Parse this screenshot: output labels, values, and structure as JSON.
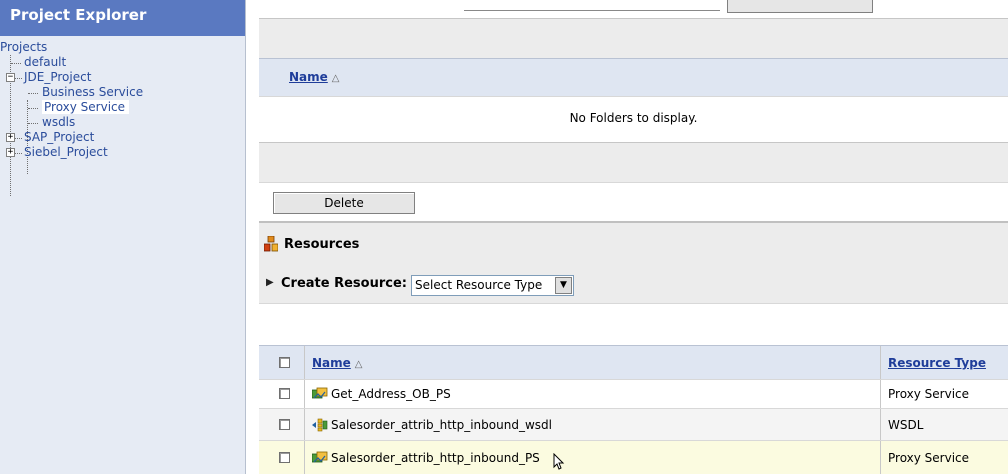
{
  "sidebar": {
    "title": "Project Explorer",
    "root_label": "Projects",
    "items": [
      {
        "label": "default"
      },
      {
        "label": "JDE_Project",
        "expander": "−"
      },
      {
        "label": "Business Service"
      },
      {
        "label": "Proxy Service"
      },
      {
        "label": "wsdls"
      },
      {
        "label": "SAP_Project",
        "expander": "+"
      },
      {
        "label": "Siebel_Project",
        "expander": "+"
      }
    ]
  },
  "folders": {
    "name_header": "Name",
    "sort_indicator": "△",
    "empty_message": "No Folders to display.",
    "delete_label": "Delete"
  },
  "resources": {
    "section_title": "Resources",
    "create_label": "Create Resource:",
    "select_value": "Select Resource Type",
    "columns": {
      "name": "Name",
      "type": "Resource Type"
    },
    "sort_indicator": "△",
    "rows": [
      {
        "name": "Get_Address_OB_PS",
        "type": "Proxy Service",
        "icon": "proxy-service-icon"
      },
      {
        "name": "Salesorder_attrib_http_inbound_wsdl",
        "type": "WSDL",
        "icon": "wsdl-icon"
      },
      {
        "name": "Salesorder_attrib_http_inbound_PS",
        "type": "Proxy Service",
        "icon": "proxy-service-icon"
      }
    ]
  },
  "colors": {
    "sidebar_header": "#5a79c1",
    "sidebar_bg": "#e6ebf4",
    "link": "#1f3d9a",
    "highlight_row": "#fbfbe0"
  }
}
